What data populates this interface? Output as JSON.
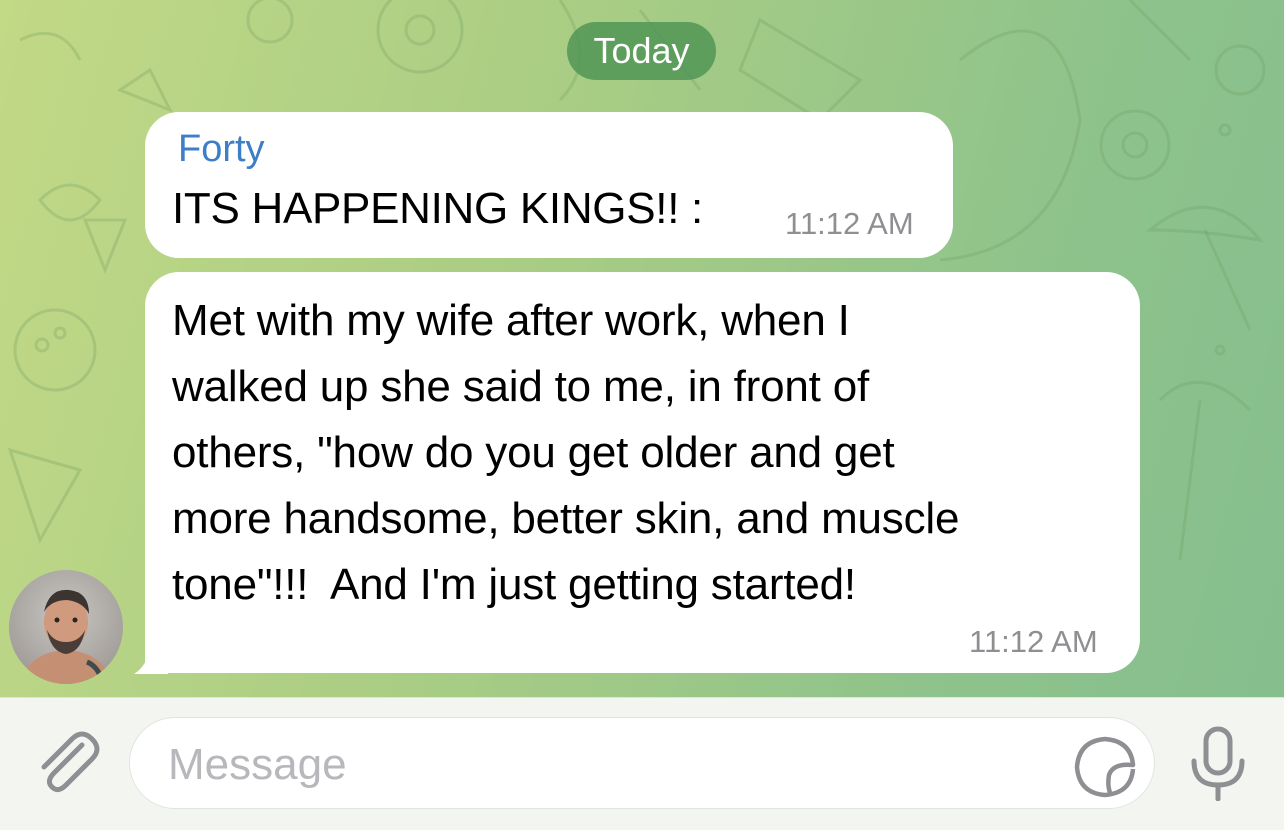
{
  "date_separator": "Today",
  "messages": [
    {
      "sender": "Forty",
      "text": "ITS HAPPENING KINGS!! :",
      "time": "11:12 AM"
    },
    {
      "text": "Met with my wife after work, when I\nwalked up she said to me, in front of\nothers, \"how do you get older and get\nmore handsome, better skin, and muscle\ntone\"!!!  And I'm just getting started!",
      "time": "11:12 AM"
    }
  ],
  "composer": {
    "placeholder": "Message"
  },
  "icons": {
    "attach": "paperclip-icon",
    "sticker": "sticker-icon",
    "mic": "microphone-icon"
  },
  "colors": {
    "sender_name": "#3d7ec7",
    "date_pill": "#4e9454",
    "bubble": "#ffffff",
    "timestamp": "#8e8e93",
    "input_bar": "#f3f5f1"
  }
}
